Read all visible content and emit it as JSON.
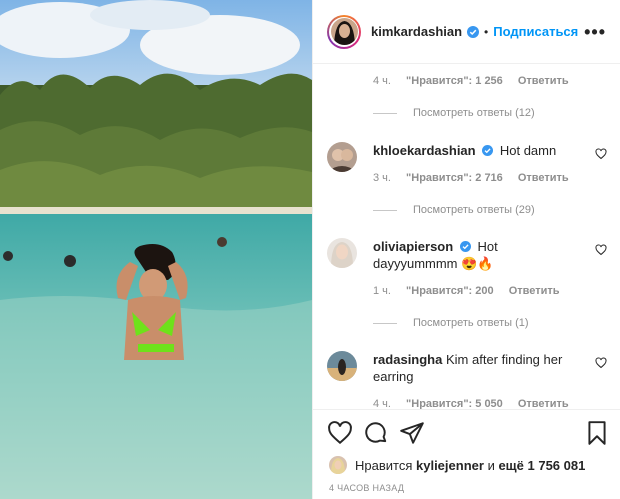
{
  "header": {
    "username": "kimkardashian",
    "separator": "•",
    "follow_label": "Подписаться",
    "more_icon": "•••"
  },
  "comments": [
    {
      "time": "4 ч.",
      "likes": "\"Нравится\": 1 256",
      "reply": "Ответить",
      "view_replies": "Посмотреть ответы (12)"
    },
    {
      "username": "khloekardashian",
      "verified": true,
      "text": "Hot damn",
      "time": "3 ч.",
      "likes": "\"Нравится\": 2 716",
      "reply": "Ответить",
      "view_replies": "Посмотреть ответы (29)"
    },
    {
      "username": "oliviapierson",
      "verified": true,
      "text": "Hot dayyyummmm 😍🔥",
      "time": "1 ч.",
      "likes": "\"Нравится\": 200",
      "reply": "Ответить",
      "view_replies": "Посмотреть ответы (1)"
    },
    {
      "username": "radasingha",
      "verified": false,
      "text": "Kim after finding her earring",
      "time": "4 ч.",
      "likes": "\"Нравится\": 5 050",
      "reply": "Ответить"
    }
  ],
  "likes_line": {
    "prefix": "Нравится",
    "user": "kyliejenner",
    "middle": "и",
    "count": "ещё 1 756 081"
  },
  "timestamp": "4 ЧАСОВ НАЗАД",
  "colors": {
    "accent": "#0095f6",
    "verified": "#3897f0",
    "muted": "#8e8e8e"
  },
  "icons": [
    "heart-icon",
    "comment-icon",
    "share-icon",
    "bookmark-icon",
    "verified-icon",
    "more-icon"
  ]
}
